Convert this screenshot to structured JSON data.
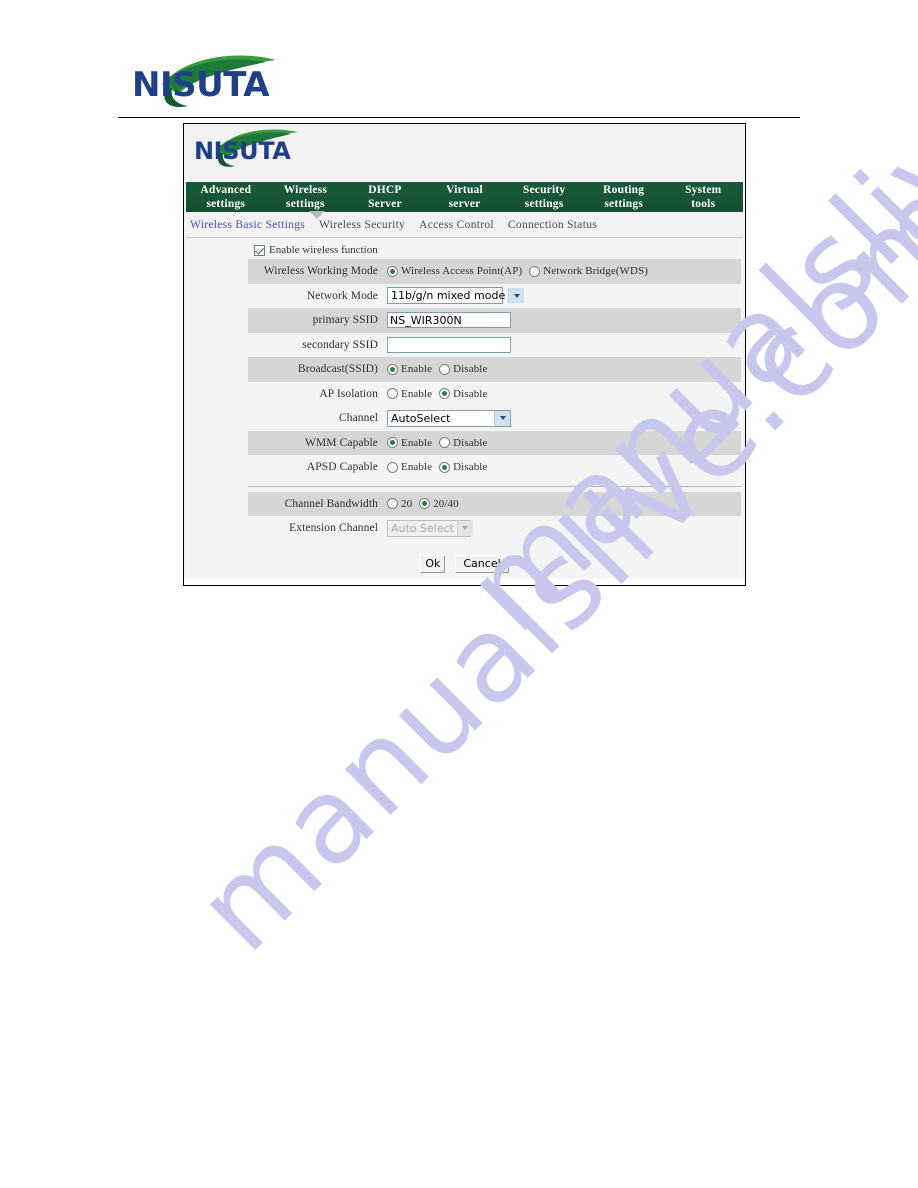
{
  "watermark": {
    "line1": "manualslive.com",
    "line2": "manualslive.com",
    "color": "#c8c8ee"
  },
  "page_header": {
    "brand": "NISUTA"
  },
  "router_ui": {
    "brand": "NISUTA",
    "main_nav": [
      {
        "label": "Advanced\nsettings"
      },
      {
        "label": "Wireless\nsettings"
      },
      {
        "label": "DHCP\nServer"
      },
      {
        "label": "Virtual\nserver"
      },
      {
        "label": "Security\nsettings"
      },
      {
        "label": "Routing\nsettings"
      },
      {
        "label": "System\ntools"
      }
    ],
    "sub_nav": [
      {
        "label": "Wireless Basic Settings",
        "active": true
      },
      {
        "label": "Wireless Security",
        "active": false
      },
      {
        "label": "Access Control",
        "active": false
      },
      {
        "label": "Connection Status",
        "active": false
      }
    ],
    "enable_wireless": {
      "label": "Enable wireless function",
      "checked": true
    },
    "rows": {
      "working_mode": {
        "label": "Wireless Working Mode",
        "opt1": "Wireless Access Point(AP)",
        "opt2": "Network Bridge(WDS)"
      },
      "network_mode": {
        "label": "Network Mode",
        "value": "11b/g/n mixed mode"
      },
      "primary_ssid": {
        "label": "primary SSID",
        "value": "NS_WIR300N"
      },
      "secondary_ssid": {
        "label": "secondary SSID",
        "value": ""
      },
      "broadcast_ssid": {
        "label": "Broadcast(SSID)",
        "opt1": "Enable",
        "opt2": "Disable"
      },
      "ap_isolation": {
        "label": "AP Isolation",
        "opt1": "Enable",
        "opt2": "Disable"
      },
      "channel": {
        "label": "Channel",
        "value": "AutoSelect"
      },
      "wmm_capable": {
        "label": "WMM Capable",
        "opt1": "Enable",
        "opt2": "Disable"
      },
      "apsd_capable": {
        "label": "APSD Capable",
        "opt1": "Enable",
        "opt2": "Disable"
      },
      "channel_bandwidth": {
        "label": "Channel Bandwidth",
        "opt1": "20",
        "opt2": "20/40"
      },
      "extension_channel": {
        "label": "Extension Channel",
        "value": "Auto Select"
      }
    },
    "buttons": {
      "ok": "Ok",
      "cancel": "Cancel"
    },
    "colors": {
      "nav_green": "#1c5b3c",
      "subnav_active": "#4a4ad0",
      "row_shade": "#d6d6d6",
      "logo_blue": "#1f3f86",
      "logo_green": "#2d8a3e"
    }
  }
}
